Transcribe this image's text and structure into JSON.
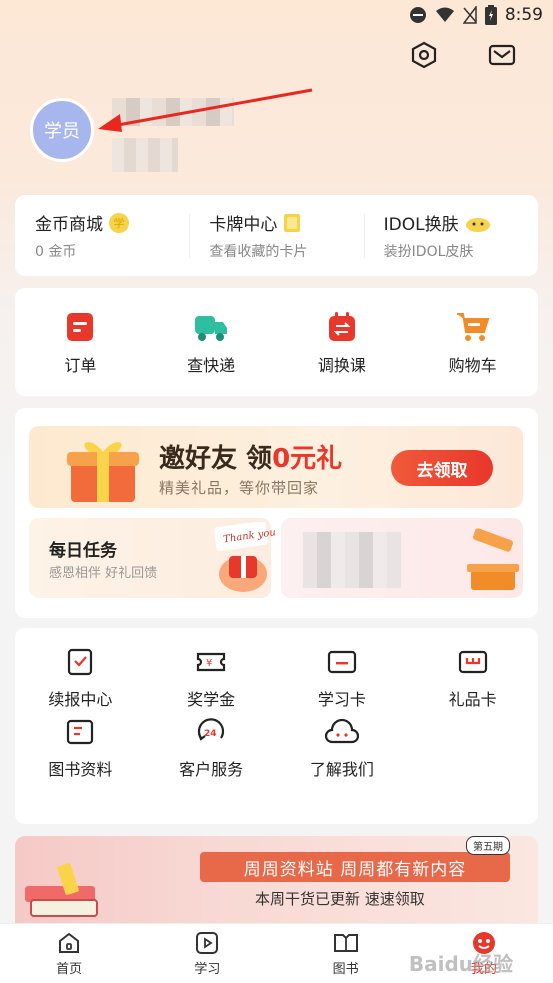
{
  "status_bar": {
    "time": "8:59"
  },
  "profile": {
    "avatar_text": "学员"
  },
  "coins": [
    {
      "title": "金币商城",
      "sub": "0 金币",
      "badge": "学"
    },
    {
      "title": "卡牌中心",
      "sub": "查看收藏的卡片",
      "badge": ""
    },
    {
      "title": "IDOL换肤",
      "sub": "装扮IDOL皮肤",
      "badge": ""
    }
  ],
  "quick_actions": [
    {
      "label": "订单",
      "icon": "order-icon",
      "color": "#e8372b"
    },
    {
      "label": "查快递",
      "icon": "truck-icon",
      "color": "#2fbfa0"
    },
    {
      "label": "调换课",
      "icon": "calendar-swap-icon",
      "color": "#e8372b"
    },
    {
      "label": "购物车",
      "icon": "cart-icon",
      "color": "#f28c28"
    }
  ],
  "invite": {
    "title_a": "邀好友 领",
    "title_b": "0元礼",
    "subtitle": "精美礼品，等你带回家",
    "button": "去领取"
  },
  "daily": {
    "title": "每日任务",
    "subtitle": "感恩相伴 好礼回馈",
    "card_text": "Thank you"
  },
  "services": [
    {
      "label": "续报中心",
      "icon": "renew-icon"
    },
    {
      "label": "奖学金",
      "icon": "scholarship-icon"
    },
    {
      "label": "学习卡",
      "icon": "study-card-icon"
    },
    {
      "label": "礼品卡",
      "icon": "gift-card-icon"
    },
    {
      "label": "图书资料",
      "icon": "book-icon"
    },
    {
      "label": "客户服务",
      "icon": "service-24-icon"
    },
    {
      "label": "了解我们",
      "icon": "cloud-face-icon"
    }
  ],
  "banner": {
    "headline": "周周资料站  周周都有新内容",
    "subline": "本周干货已更新 速速领取",
    "tag": "第五期"
  },
  "bottom_nav": [
    {
      "label": "首页",
      "icon": "home-icon",
      "active": false
    },
    {
      "label": "学习",
      "icon": "play-icon",
      "active": false
    },
    {
      "label": "图书",
      "icon": "book-open-icon",
      "active": false
    },
    {
      "label": "我的",
      "icon": "me-icon",
      "active": true
    }
  ],
  "accent": "#e8372b",
  "watermark": "Baidu经验"
}
